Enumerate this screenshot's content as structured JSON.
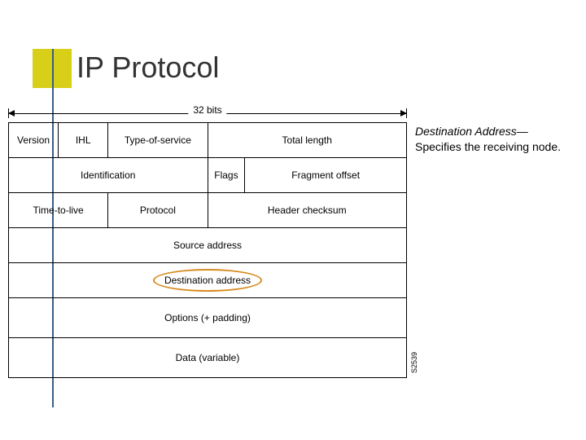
{
  "title": "IP Protocol",
  "dimension_label": "32 bits",
  "header": {
    "row0": [
      "Version",
      "IHL",
      "Type-of-service",
      "Total length"
    ],
    "row1": [
      "Identification",
      "Flags",
      "Fragment offset"
    ],
    "row2": [
      "Time-to-live",
      "Protocol",
      "Header checksum"
    ],
    "row3": "Source address",
    "row4": "Destination address",
    "row5": "Options (+ padding)",
    "row6": "Data (variable)"
  },
  "figure_number": "S2539",
  "annotation": {
    "term": "Destination Address",
    "dash": "—",
    "body": "Specifies the receiving node."
  }
}
